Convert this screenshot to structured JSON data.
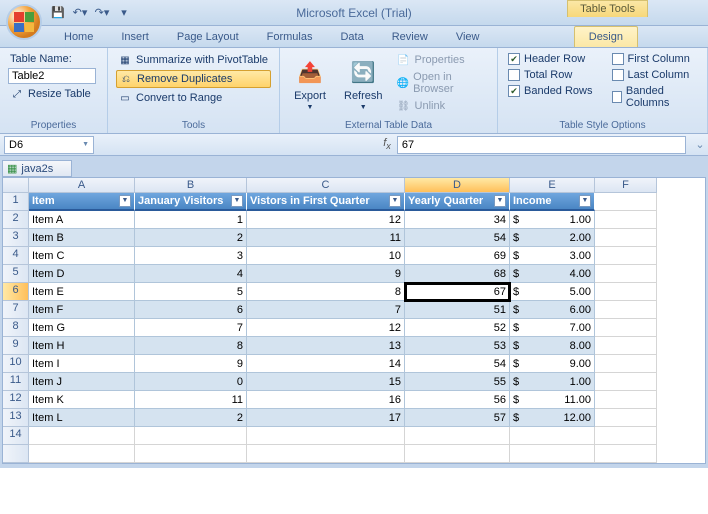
{
  "app": {
    "title": "Microsoft Excel (Trial)",
    "context_tool_group": "Table Tools",
    "workbook_tab": "java2s"
  },
  "tabs": [
    "Home",
    "Insert",
    "Page Layout",
    "Formulas",
    "Data",
    "Review",
    "View",
    "Design"
  ],
  "ribbon": {
    "properties": {
      "label": "Properties",
      "table_name_label": "Table Name:",
      "table_name_value": "Table2",
      "resize": "Resize Table"
    },
    "tools": {
      "label": "Tools",
      "pivot": "Summarize with PivotTable",
      "remove_dup": "Remove Duplicates",
      "to_range": "Convert to Range"
    },
    "ext": {
      "label": "External Table Data",
      "export": "Export",
      "refresh": "Refresh",
      "props": "Properties",
      "browser": "Open in Browser",
      "unlink": "Unlink"
    },
    "styleopt": {
      "label": "Table Style Options",
      "header_row": "Header Row",
      "total_row": "Total Row",
      "banded_rows": "Banded Rows",
      "first_col": "First Column",
      "last_col": "Last Column",
      "banded_cols": "Banded Columns"
    }
  },
  "namebox": "D6",
  "formula": "67",
  "cols": [
    "A",
    "B",
    "C",
    "D",
    "E",
    "F"
  ],
  "headers": [
    "Item",
    "January Visitors",
    "Vistors in First Quarter",
    "Yearly Quarter",
    "Income"
  ],
  "rows": [
    {
      "item": "Item A",
      "jan": "1",
      "q1": "12",
      "yq": "34",
      "inc": "1.00"
    },
    {
      "item": "Item B",
      "jan": "2",
      "q1": "11",
      "yq": "54",
      "inc": "2.00"
    },
    {
      "item": "Item C",
      "jan": "3",
      "q1": "10",
      "yq": "69",
      "inc": "3.00"
    },
    {
      "item": "Item D",
      "jan": "4",
      "q1": "9",
      "yq": "68",
      "inc": "4.00"
    },
    {
      "item": "Item E",
      "jan": "5",
      "q1": "8",
      "yq": "67",
      "inc": "5.00"
    },
    {
      "item": "Item F",
      "jan": "6",
      "q1": "7",
      "yq": "51",
      "inc": "6.00"
    },
    {
      "item": "Item G",
      "jan": "7",
      "q1": "12",
      "yq": "52",
      "inc": "7.00"
    },
    {
      "item": "Item H",
      "jan": "8",
      "q1": "13",
      "yq": "53",
      "inc": "8.00"
    },
    {
      "item": "Item I",
      "jan": "9",
      "q1": "14",
      "yq": "54",
      "inc": "9.00"
    },
    {
      "item": "Item J",
      "jan": "0",
      "q1": "15",
      "yq": "55",
      "inc": "1.00"
    },
    {
      "item": "Item K",
      "jan": "11",
      "q1": "16",
      "yq": "56",
      "inc": "11.00"
    },
    {
      "item": "Item L",
      "jan": "2",
      "q1": "17",
      "yq": "57",
      "inc": "12.00"
    }
  ],
  "active_cell": {
    "row": 5,
    "col": "D"
  },
  "currency": "$"
}
